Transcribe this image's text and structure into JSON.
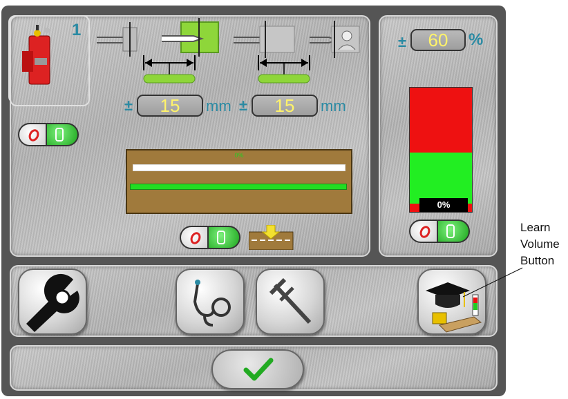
{
  "sensor": {
    "channel_number": "1"
  },
  "tolerance_left": {
    "pm": "±",
    "value": "15",
    "unit": "mm"
  },
  "tolerance_right": {
    "pm": "±",
    "value": "15",
    "unit": "mm"
  },
  "volume": {
    "pm": "±",
    "value": "60",
    "unit": "%",
    "level_label": "0%"
  },
  "signal_bar": {
    "label": "0%",
    "white_level": 1.0,
    "green_level": 1.0
  },
  "volume_bar": {
    "red_fraction": 0.52,
    "green_fraction": 0.48
  },
  "footer": {
    "confirm_icon": "checkmark-icon"
  },
  "callout": {
    "line1": "Learn",
    "line2": "Volume",
    "line3": "Button"
  },
  "colors": {
    "accent": "#2a8aa3",
    "value_text": "#fff36a",
    "ok_green": "#22cc22",
    "alarm_red": "#ee1111",
    "track_brown": "#a07a3c"
  }
}
